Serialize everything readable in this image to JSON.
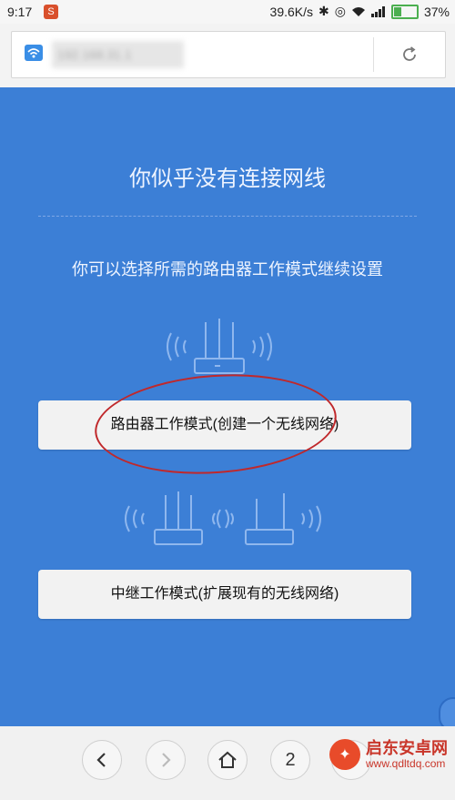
{
  "status_bar": {
    "time": "9:17",
    "app_badge": "S",
    "network_speed": "39.6K/s",
    "battery_percent": "37%",
    "battery_level": 0.37
  },
  "address_bar": {
    "url": "192.168.31.1",
    "icons": {
      "site": "wifi-icon",
      "reload": "reload-icon"
    }
  },
  "page": {
    "title": "你似乎没有连接网线",
    "subtitle": "你可以选择所需的路由器工作模式继续设置",
    "router_mode_button": "路由器工作模式(创建一个无线网络)",
    "repeater_mode_button": "中继工作模式(扩展现有的无线网络)",
    "accent_color": "#3c7fd6",
    "annotation_color": "#c0282b"
  },
  "bottom_nav": {
    "tab_count": "2",
    "icons": {
      "back": "back-icon",
      "forward": "forward-icon",
      "home": "home-icon",
      "menu": "menu-icon"
    }
  },
  "watermark": {
    "name": "启东安卓网",
    "url": "www.qdltdq.com"
  }
}
